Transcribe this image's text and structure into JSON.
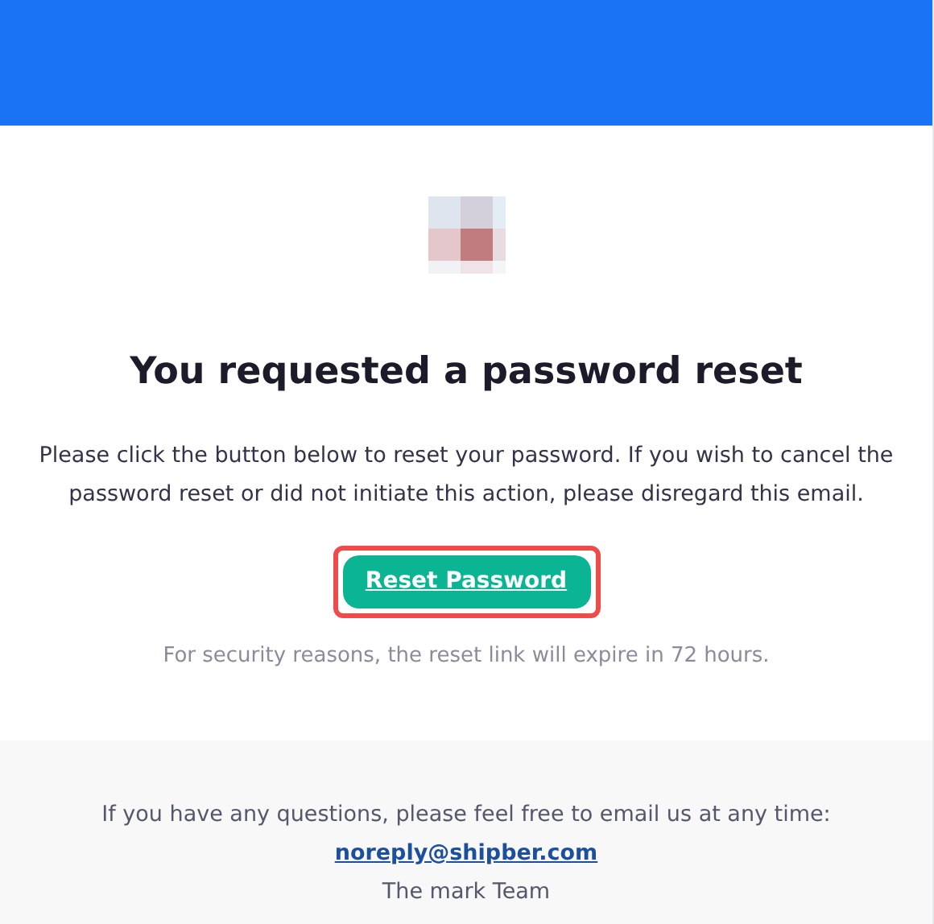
{
  "header": {
    "kind": "banner"
  },
  "title": "You requested a password reset",
  "message": "Please click the button below to reset your password. If you wish to cancel the password reset or did not initiate this action, please disregard this email.",
  "button": {
    "label": "Reset Password",
    "highlighted": true
  },
  "expiry_note": "For security reasons, the reset link will expire in 72 hours.",
  "footer": {
    "question": "If you have any questions, please feel free to email us at any time:",
    "email": "noreply@shipber.com",
    "signature": "The mark Team"
  }
}
